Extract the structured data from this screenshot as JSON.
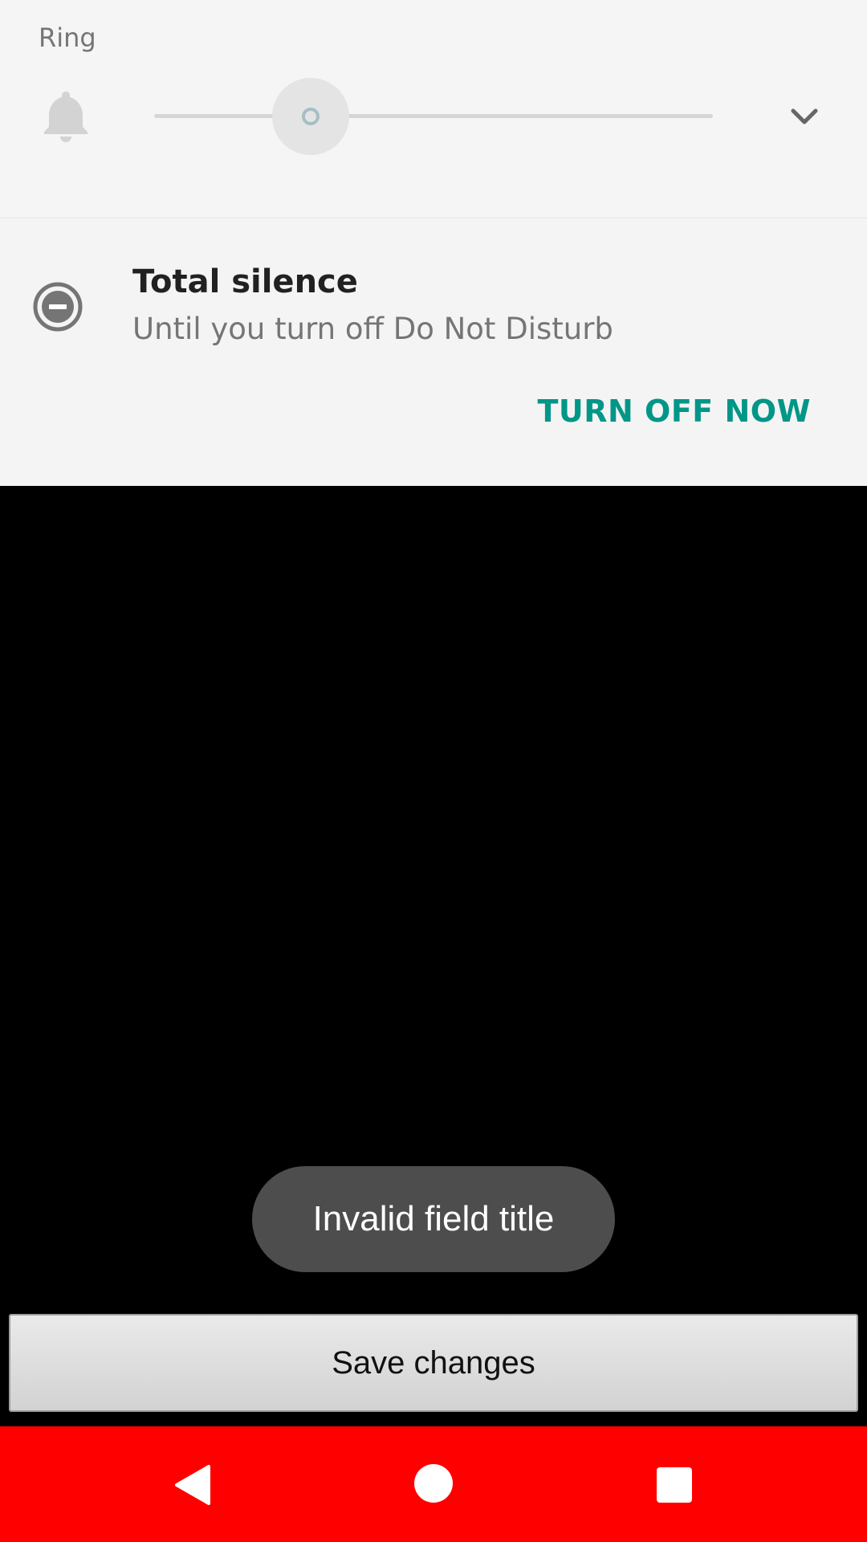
{
  "volume_panel": {
    "stream_label": "Ring",
    "stream_icon": "bell-icon",
    "expand_icon": "chevron-down-icon",
    "slider_level": 0.28
  },
  "dnd_panel": {
    "icon": "do-not-disturb-icon",
    "title": "Total silence",
    "subtitle": "Until you turn off Do Not Disturb",
    "action_label": "TURN OFF NOW",
    "accent_color": "#009688"
  },
  "toast": {
    "message": "Invalid field title"
  },
  "save_button": {
    "label": "Save changes"
  },
  "nav_bar": {
    "background_color": "#ff0000",
    "items": [
      "back-icon",
      "home-icon",
      "recents-icon"
    ]
  }
}
